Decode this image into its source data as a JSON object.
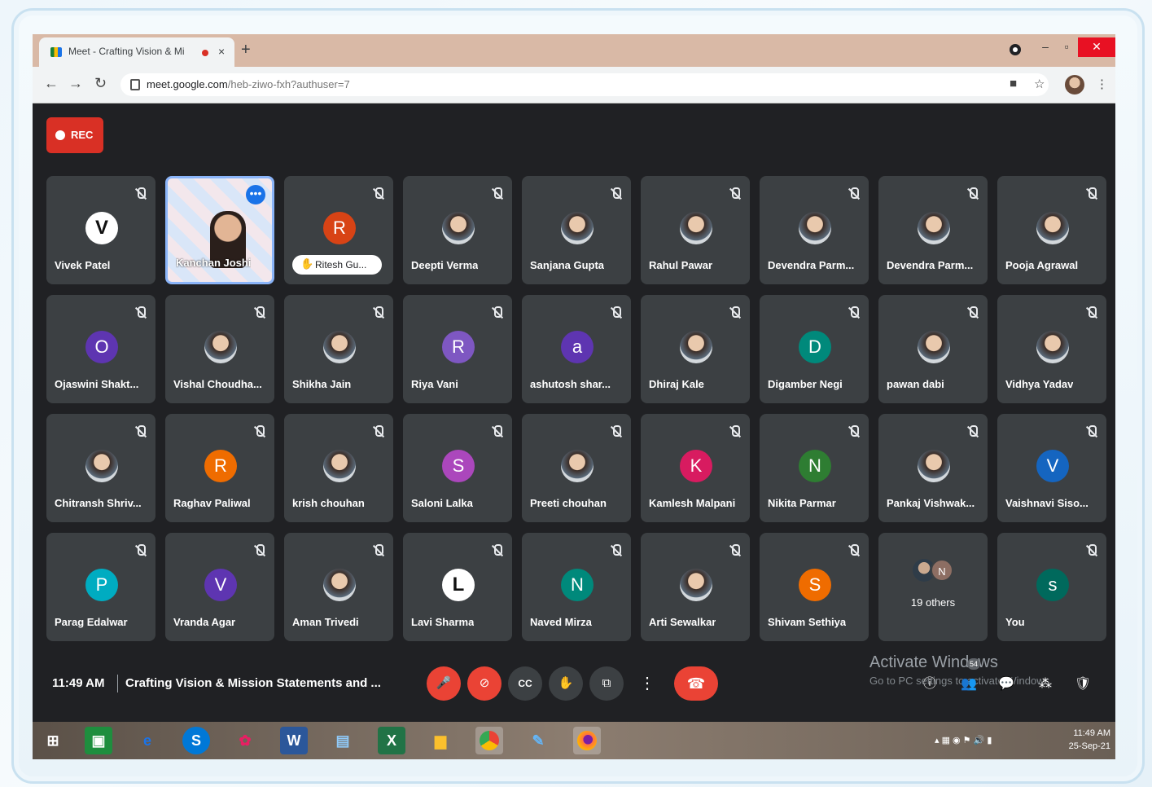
{
  "browser": {
    "tab_title": "Meet - Crafting Vision & Mi",
    "tab_close": "×",
    "new_tab": "+",
    "window_min": "–",
    "window_max": "▫",
    "window_close": "✕",
    "url_host": "meet.google.com",
    "url_path": "/heb-ziwo-fxh?authuser=7"
  },
  "rec_label": "REC",
  "participants": [
    {
      "name": "Vivek Patel",
      "avatar": "logo",
      "initial": "V",
      "color": "#ffffff"
    },
    {
      "name": "Kanchan Joshi",
      "avatar": "active-video",
      "initial": "",
      "color": "#8ab4f8"
    },
    {
      "name": "Ritesh Gu...",
      "avatar": "letter",
      "initial": "R",
      "color": "#d84315",
      "hand_raised": true
    },
    {
      "name": "Deepti Verma",
      "avatar": "photo",
      "initial": "",
      "color": ""
    },
    {
      "name": "Sanjana Gupta",
      "avatar": "photo",
      "initial": "",
      "color": ""
    },
    {
      "name": "Rahul Pawar",
      "avatar": "photo",
      "initial": "",
      "color": ""
    },
    {
      "name": "Devendra Parm...",
      "avatar": "photo",
      "initial": "",
      "color": ""
    },
    {
      "name": "Devendra Parm...",
      "avatar": "photo",
      "initial": "",
      "color": ""
    },
    {
      "name": "Pooja Agrawal",
      "avatar": "photo",
      "initial": "",
      "color": ""
    },
    {
      "name": "Ojaswini Shakt...",
      "avatar": "letter",
      "initial": "O",
      "color": "#5e35b1"
    },
    {
      "name": "Vishal Choudha...",
      "avatar": "photo",
      "initial": "",
      "color": ""
    },
    {
      "name": "Shikha Jain",
      "avatar": "photo",
      "initial": "",
      "color": ""
    },
    {
      "name": "Riya Vani",
      "avatar": "letter",
      "initial": "R",
      "color": "#7e57c2"
    },
    {
      "name": "ashutosh shar...",
      "avatar": "letter",
      "initial": "a",
      "color": "#5e35b1"
    },
    {
      "name": "Dhiraj Kale",
      "avatar": "photo",
      "initial": "",
      "color": ""
    },
    {
      "name": "Digamber Negi",
      "avatar": "letter",
      "initial": "D",
      "color": "#00897b"
    },
    {
      "name": "pawan dabi",
      "avatar": "photo",
      "initial": "",
      "color": ""
    },
    {
      "name": "Vidhya Yadav",
      "avatar": "photo",
      "initial": "",
      "color": ""
    },
    {
      "name": "Chitransh Shriv...",
      "avatar": "photo",
      "initial": "",
      "color": ""
    },
    {
      "name": "Raghav Paliwal",
      "avatar": "letter",
      "initial": "R",
      "color": "#ef6c00"
    },
    {
      "name": "krish chouhan",
      "avatar": "photo",
      "initial": "",
      "color": ""
    },
    {
      "name": "Saloni Lalka",
      "avatar": "letter",
      "initial": "S",
      "color": "#ab47bc"
    },
    {
      "name": "Preeti chouhan",
      "avatar": "photo",
      "initial": "",
      "color": ""
    },
    {
      "name": "Kamlesh Malpani",
      "avatar": "letter",
      "initial": "K",
      "color": "#d81b60"
    },
    {
      "name": "Nikita Parmar",
      "avatar": "letter",
      "initial": "N",
      "color": "#2e7d32"
    },
    {
      "name": "Pankaj Vishwak...",
      "avatar": "photo",
      "initial": "",
      "color": ""
    },
    {
      "name": "Vaishnavi Siso...",
      "avatar": "letter",
      "initial": "V",
      "color": "#1565c0"
    },
    {
      "name": "Parag Edalwar",
      "avatar": "letter",
      "initial": "P",
      "color": "#00acc1"
    },
    {
      "name": "Vranda Agar",
      "avatar": "letter",
      "initial": "V",
      "color": "#5e35b1"
    },
    {
      "name": "Aman Trivedi",
      "avatar": "photo",
      "initial": "",
      "color": ""
    },
    {
      "name": "Lavi Sharma",
      "avatar": "logo",
      "initial": "L",
      "color": "#ffffff"
    },
    {
      "name": "Naved Mirza",
      "avatar": "letter",
      "initial": "N",
      "color": "#00897b"
    },
    {
      "name": "Arti Sewalkar",
      "avatar": "photo",
      "initial": "",
      "color": ""
    },
    {
      "name": "Shivam Sethiya",
      "avatar": "letter",
      "initial": "S",
      "color": "#ef6c00"
    },
    {
      "name": "19 others",
      "avatar": "others",
      "initial": "N",
      "color": ""
    },
    {
      "name": "You",
      "avatar": "letter",
      "initial": "s",
      "color": "#00695c"
    }
  ],
  "bottom": {
    "time": "11:49 AM",
    "meeting_title": "Crafting Vision & Mission Statements and ...",
    "people_count": "54",
    "activate_line1": "Activate Windows",
    "activate_line2": "Go to PC settings to activate Windows."
  },
  "taskbar": {
    "clock_time": "11:49 AM",
    "clock_date": "25-Sep-21"
  }
}
